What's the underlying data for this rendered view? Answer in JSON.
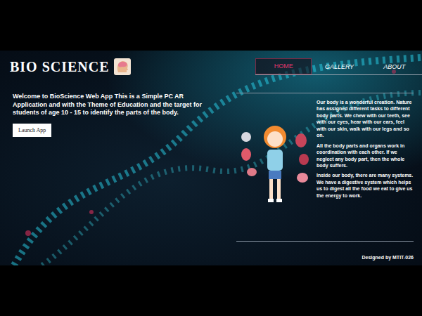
{
  "app": {
    "title": "BIO SCIENCE"
  },
  "nav": [
    {
      "label": "HOME",
      "selected": true
    },
    {
      "label": "GALLERY",
      "selected": false
    },
    {
      "label": "ABOUT",
      "selected": false
    }
  ],
  "intro": {
    "text": "Welcome to BioScience Web App This is a Simple PC AR Application and with the Theme of Education and the target for students of age 10 - 15 to identify the parts of the body.",
    "button": "Launch App"
  },
  "about": {
    "paragraphs": [
      "Our body is a wonderful creation. Nature has assigned different tasks to different body parts. We chew with our teeth, see with our eyes, hear with our ears, feel with our skin, walk with our legs and so on.",
      "All the body parts and organs work in coordination with each other. If we neglect any body part, then the whole body suffers.",
      "Inside our body, there are many systems. We have a digestive system which helps us to digest all the food we eat to give us the energy to work."
    ]
  },
  "footer": "Designed by MTIT-026"
}
